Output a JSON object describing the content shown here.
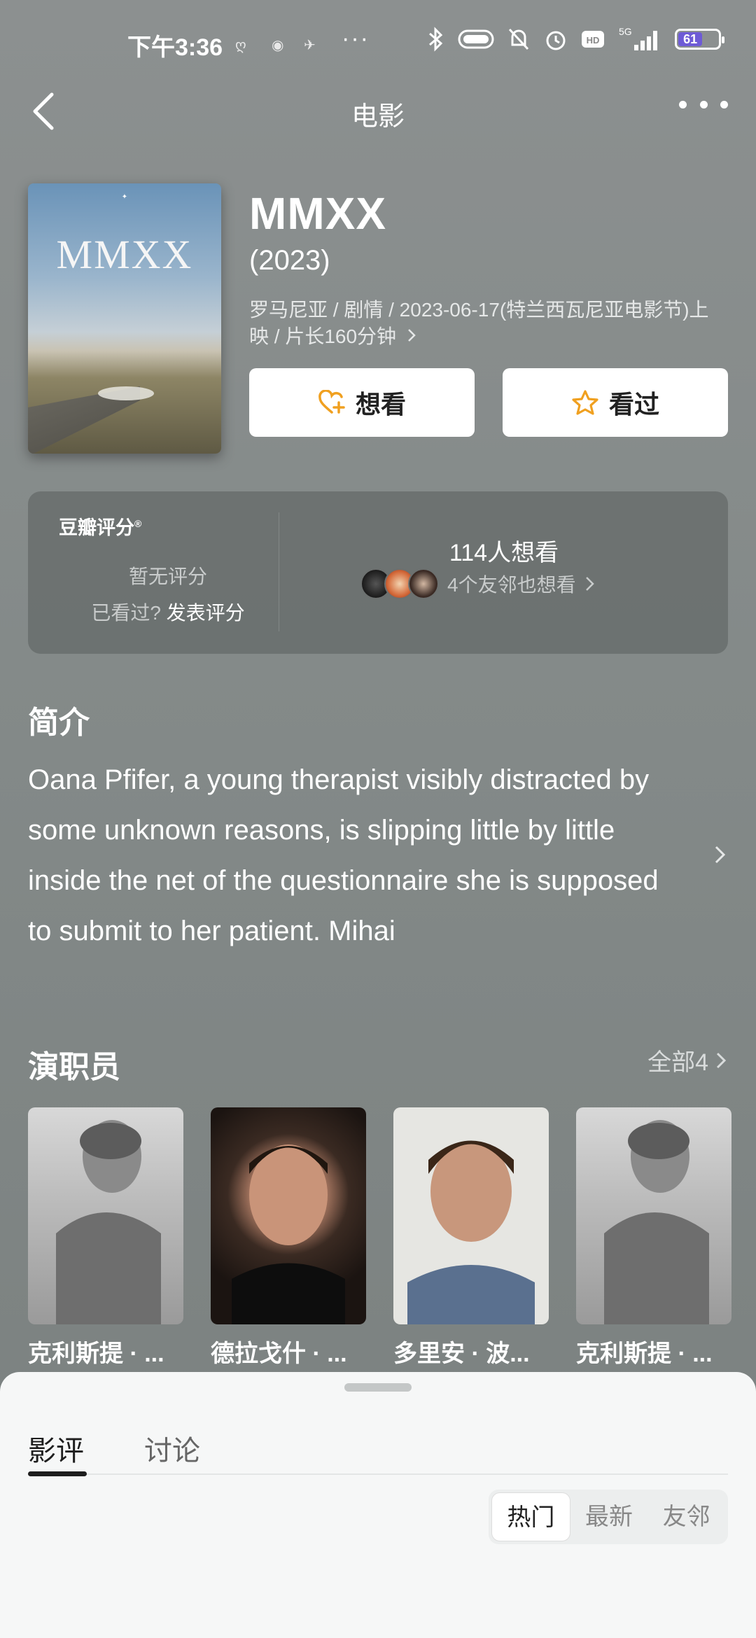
{
  "status": {
    "time": "下午3:36",
    "dots": "···",
    "network": "5G",
    "battery": "61"
  },
  "nav": {
    "title": "电影"
  },
  "poster": {
    "title": "MMXX"
  },
  "movie": {
    "title": "MMXX",
    "year": "(2023)",
    "meta": "罗马尼亚 / 剧情 / 2023-06-17(特兰西瓦尼亚电影节)上映 / 片长160分钟",
    "want_label": "想看",
    "seen_label": "看过"
  },
  "rating": {
    "label": "豆瓣评分",
    "mark": "®",
    "none": "暂无评分",
    "seen_prompt": "已看过?",
    "post_label": "发表评分",
    "want_count": "114人想看",
    "friends_text": "4个友邻也想看"
  },
  "intro": {
    "title": "简介",
    "text": "Oana Pfifer, a young therapist visibly distracted by some unknown reasons, is slipping little by little inside the net of the questionnaire she is supposed to submit to her patient. Mihai"
  },
  "cast": {
    "title": "演职员",
    "all_label": "全部4",
    "members": [
      {
        "name": "克利斯提 · ..."
      },
      {
        "name": "德拉戈什 · ..."
      },
      {
        "name": "多里安 · 波..."
      },
      {
        "name": "克利斯提 · ..."
      }
    ]
  },
  "sheet": {
    "tabs": [
      "影评",
      "讨论"
    ],
    "sort": [
      "热门",
      "最新",
      "友邻"
    ]
  },
  "colors": {
    "accent_orange": "#f0a020",
    "battery": "#6e5bd6"
  }
}
